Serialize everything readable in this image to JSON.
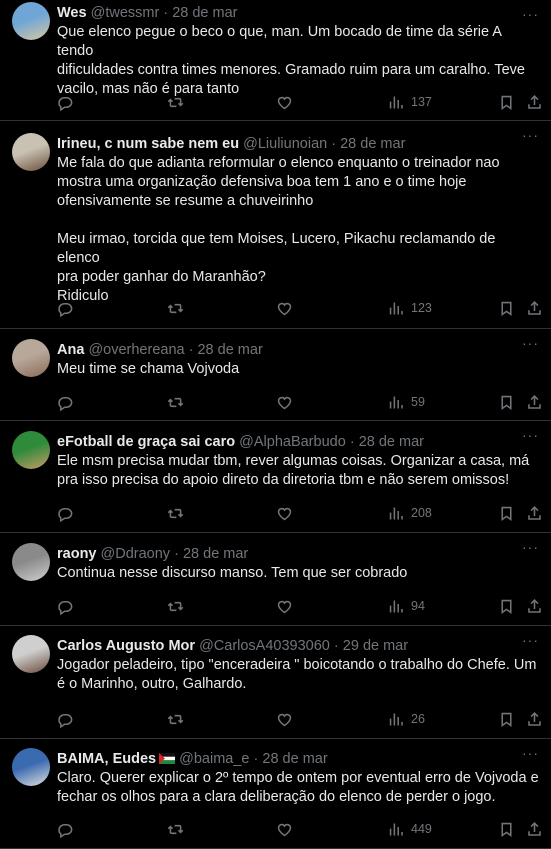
{
  "tweets": [
    {
      "name": "Wes",
      "handle": "@twessmr",
      "date": "28 de mar",
      "text": "Que elenco pegue o beco o que, man. Um bocado de time da série A tendo\ndificuldades contra times menores. Gramado ruim para um caralho. Teve\nvacilo, mas não é para tanto",
      "views": "137",
      "avatar_colors": [
        "#6fa6d6",
        "#d9c7a3"
      ]
    },
    {
      "name": "Irineu, c num sabe nem eu",
      "handle": "@Liuliunoian",
      "date": "28 de mar",
      "text": "Me fala do que adianta reformular o elenco enquanto o treinador nao\nmostra uma organização defensiva boa tem 1 ano e o time hoje\nofensivamente se resume a chuveirinho\n\nMeu irmao, torcida que tem Moises, Lucero, Pikachu reclamando de elenco\npra poder ganhar do Maranhão?\nRidiculo",
      "views": "123",
      "avatar_colors": [
        "#c9c2b3",
        "#6b4f3a"
      ]
    },
    {
      "name": "Ana",
      "handle": "@overhereana",
      "date": "28 de mar",
      "text": "Meu time se chama Vojvoda",
      "views": "59",
      "avatar_colors": [
        "#b8a89a",
        "#8a6a58"
      ]
    },
    {
      "name": "eFotball de graça sai caro",
      "handle": "@AlphaBarbudo",
      "date": "28 de mar",
      "text": "Ele msm precisa mudar tbm, rever algumas coisas. Organizar a casa, má\npra isso precisa do apoio direto da diretoria tbm e não serem omissos!",
      "views": "208",
      "avatar_colors": [
        "#2e8b3a",
        "#c89a6a"
      ]
    },
    {
      "name": "raony",
      "handle": "@Ddraony",
      "date": "28 de mar",
      "text": "Continua nesse discurso manso. Tem que ser cobrado",
      "views": "94",
      "avatar_colors": [
        "#8a8a8a",
        "#d0d0d0"
      ]
    },
    {
      "name": "Carlos Augusto Mor",
      "handle": "@CarlosA40393060",
      "date": "29 de mar",
      "text": "Jogador peladeiro, tipo \"enceradeira \" boicotando o trabalho do Chefe. Um\né o Marinho, outro, Galhardo.",
      "views": "26",
      "avatar_colors": [
        "#cfcfcf",
        "#6a4a3a"
      ]
    },
    {
      "name": "BAIMA, Eudes",
      "handle": "@baima_e",
      "date": "28 de mar",
      "text": "Claro. Querer explicar o 2º tempo de ontem por eventual erro de Vojvoda e\nfechar os olhos para a clara deliberação do elenco de perder o jogo.",
      "views": "449",
      "avatar_colors": [
        "#3a6ab0",
        "#e0e0e0"
      ]
    }
  ],
  "more_label": "···",
  "separator": "·",
  "icons": [
    "reply-icon",
    "retweet-icon",
    "like-icon",
    "views-icon",
    "bookmark-icon",
    "share-icon"
  ]
}
